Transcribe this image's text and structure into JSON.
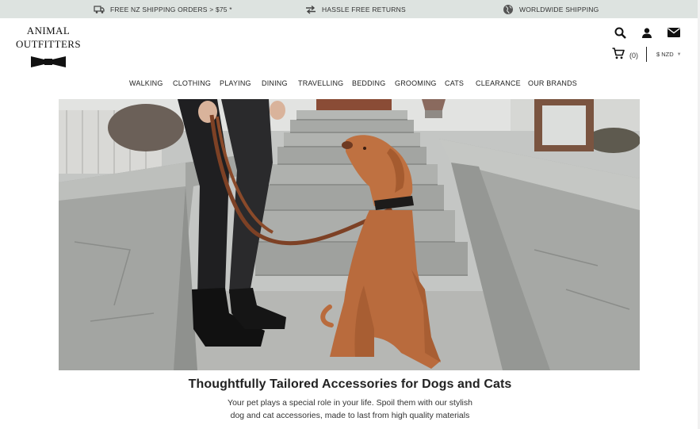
{
  "announcements": [
    {
      "icon": "delivery-truck-icon",
      "text": "FREE NZ SHIPPING ORDERS > $75 *"
    },
    {
      "icon": "returns-arrows-icon",
      "text": "HASSLE FREE RETURNS"
    },
    {
      "icon": "globe-icon",
      "text": "WORLDWIDE SHIPPING"
    }
  ],
  "logo": {
    "line1": "ANIMAL",
    "line2": "OUTFITTERS"
  },
  "header": {
    "cart_count": "(0)",
    "currency": "$ NZD"
  },
  "nav": {
    "items": [
      "WALKING",
      "CLOTHING",
      "PLAYING",
      "DINING",
      "TRAVELLING",
      "BEDDING",
      "GROOMING",
      "CATS",
      "CLEARANCE",
      "OUR BRANDS"
    ]
  },
  "hero": {
    "headline": "Thoughtfully Tailored Accessories for Dogs and Cats",
    "body_line1": "Your pet plays a special role in your life. Spoil them with our stylish",
    "body_line2": "dog and cat accessories, made to last from high quality materials"
  },
  "colors": {
    "topbar_bg": "#dde3e0",
    "text": "#222222",
    "dog": "#b86a3c",
    "leash": "#8a4a2a",
    "stone": "#a9aca9"
  }
}
